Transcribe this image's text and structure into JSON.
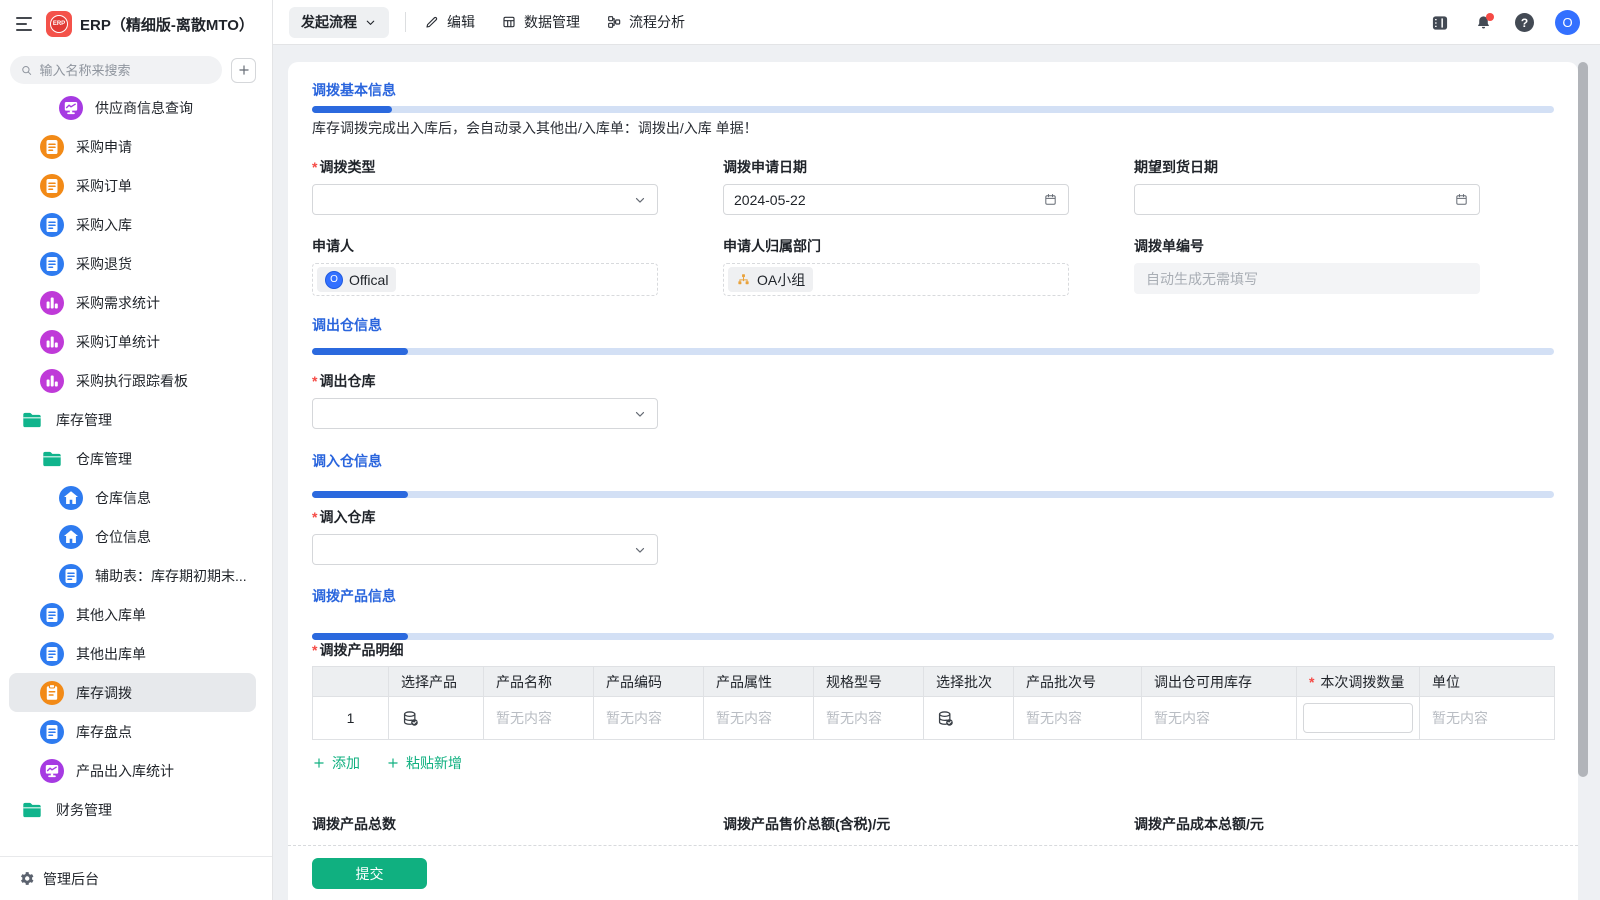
{
  "app": {
    "logo_text": "ERP",
    "title": "ERP（精细版-离散MTO）"
  },
  "sidebar": {
    "search_placeholder": "输入名称来搜索",
    "items": [
      {
        "label": "供应商信息查询"
      },
      {
        "label": "采购申请"
      },
      {
        "label": "采购订单"
      },
      {
        "label": "采购入库"
      },
      {
        "label": "采购退货"
      },
      {
        "label": "采购需求统计"
      },
      {
        "label": "采购订单统计"
      },
      {
        "label": "采购执行跟踪看板"
      },
      {
        "label": "库存管理"
      },
      {
        "label": "仓库管理"
      },
      {
        "label": "仓库信息"
      },
      {
        "label": "仓位信息"
      },
      {
        "label": "辅助表：库存期初期末..."
      },
      {
        "label": "其他入库单"
      },
      {
        "label": "其他出库单"
      },
      {
        "label": "库存调拨"
      },
      {
        "label": "库存盘点"
      },
      {
        "label": "产品出入库统计"
      },
      {
        "label": "财务管理"
      }
    ],
    "admin_label": "管理后台"
  },
  "toolbar": {
    "start_flow": "发起流程",
    "edit": "编辑",
    "data_manage": "数据管理",
    "flow_analysis": "流程分析",
    "help_glyph": "?",
    "avatar_glyph": "O"
  },
  "form": {
    "required_mark": "*",
    "basic": {
      "title": "调拨基本信息",
      "note": "库存调拨完成出入库后，会自动录入其他出/入库单：调拨出/入库 单据！"
    },
    "transfer_type_label": "调拨类型",
    "apply_date_label": "调拨申请日期",
    "apply_date_value": "2024-05-22",
    "expect_date_label": "期望到货日期",
    "applicant_label": "申请人",
    "applicant_avatar": "O",
    "applicant_tag": "Offical",
    "department_label": "申请人归属部门",
    "department_tag": "OA小组",
    "order_no_label": "调拨单编号",
    "order_no_placeholder": "自动生成无需填写",
    "out_section": {
      "title": "调出仓信息",
      "label": "调出仓库"
    },
    "in_section": {
      "title": "调入仓信息",
      "label": "调入仓库"
    },
    "product_section": {
      "title": "调拨产品信息",
      "detail_label": "调拨产品明细"
    },
    "table": {
      "headers": [
        "",
        "选择产品",
        "产品名称",
        "产品编码",
        "产品属性",
        "规格型号",
        "选择批次",
        "产品批次号",
        "调出仓可用库存",
        "本次调拨数量",
        "单位"
      ],
      "row_index": "1",
      "empty_text": "暂无内容"
    },
    "add_label": "添加",
    "paste_add_label": "粘贴新增",
    "totals": {
      "count_label": "调拨产品总数",
      "sale_label": "调拨产品售价总额(含税)/元",
      "cost_label": "调拨产品成本总额/元"
    },
    "submit_label": "提交"
  },
  "colors": {
    "accent_blue": "#2b69de",
    "section_title_blue": "#2a65dd",
    "green": "#10b080",
    "orange_icon": "#f28a17",
    "blue_icon": "#2e7bf0",
    "purple_icon": "#a63ae2",
    "magenta_icon": "#bf3ad8",
    "folder_green": "#10b48c",
    "red": "#f54a45",
    "avatar_blue": "#3370ff"
  }
}
